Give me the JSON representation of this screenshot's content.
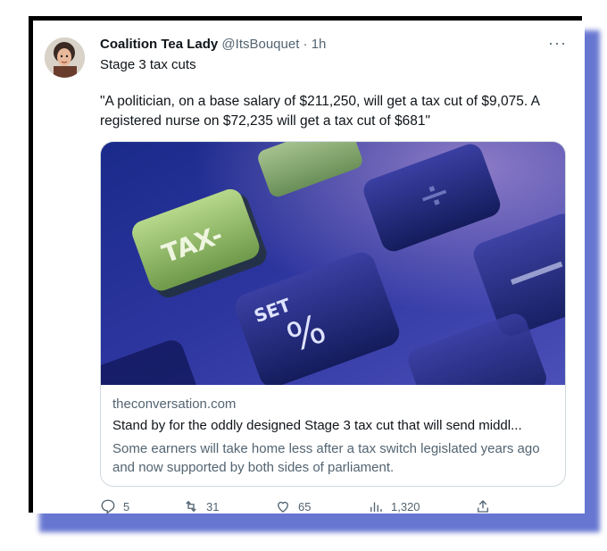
{
  "tweet": {
    "author_name": "Coalition Tea Lady",
    "author_handle": "@ItsBouquet",
    "time": "· 1h",
    "more_label": "···",
    "subtitle": "Stage 3 tax cuts",
    "text": "\"A politician, on a base salary of $211,250, will get a tax cut of $9,075. A registered nurse on $72,235 will get a tax cut of $681\""
  },
  "link_card": {
    "domain": "theconversation.com",
    "title": "Stand by for the oddly designed Stage 3 tax cut that will send middl...",
    "description": "Some earners will take home less after a tax switch legislated years ago and now supported by both sides of parliament.",
    "image_key_labels": [
      "TAX-",
      "SET",
      "%"
    ]
  },
  "actions": {
    "replies": "5",
    "reposts": "31",
    "likes": "65",
    "views": "1,320"
  },
  "colors": {
    "shadow": "#4d5fc9",
    "frame": "#000000",
    "secondary_text": "#536471"
  }
}
